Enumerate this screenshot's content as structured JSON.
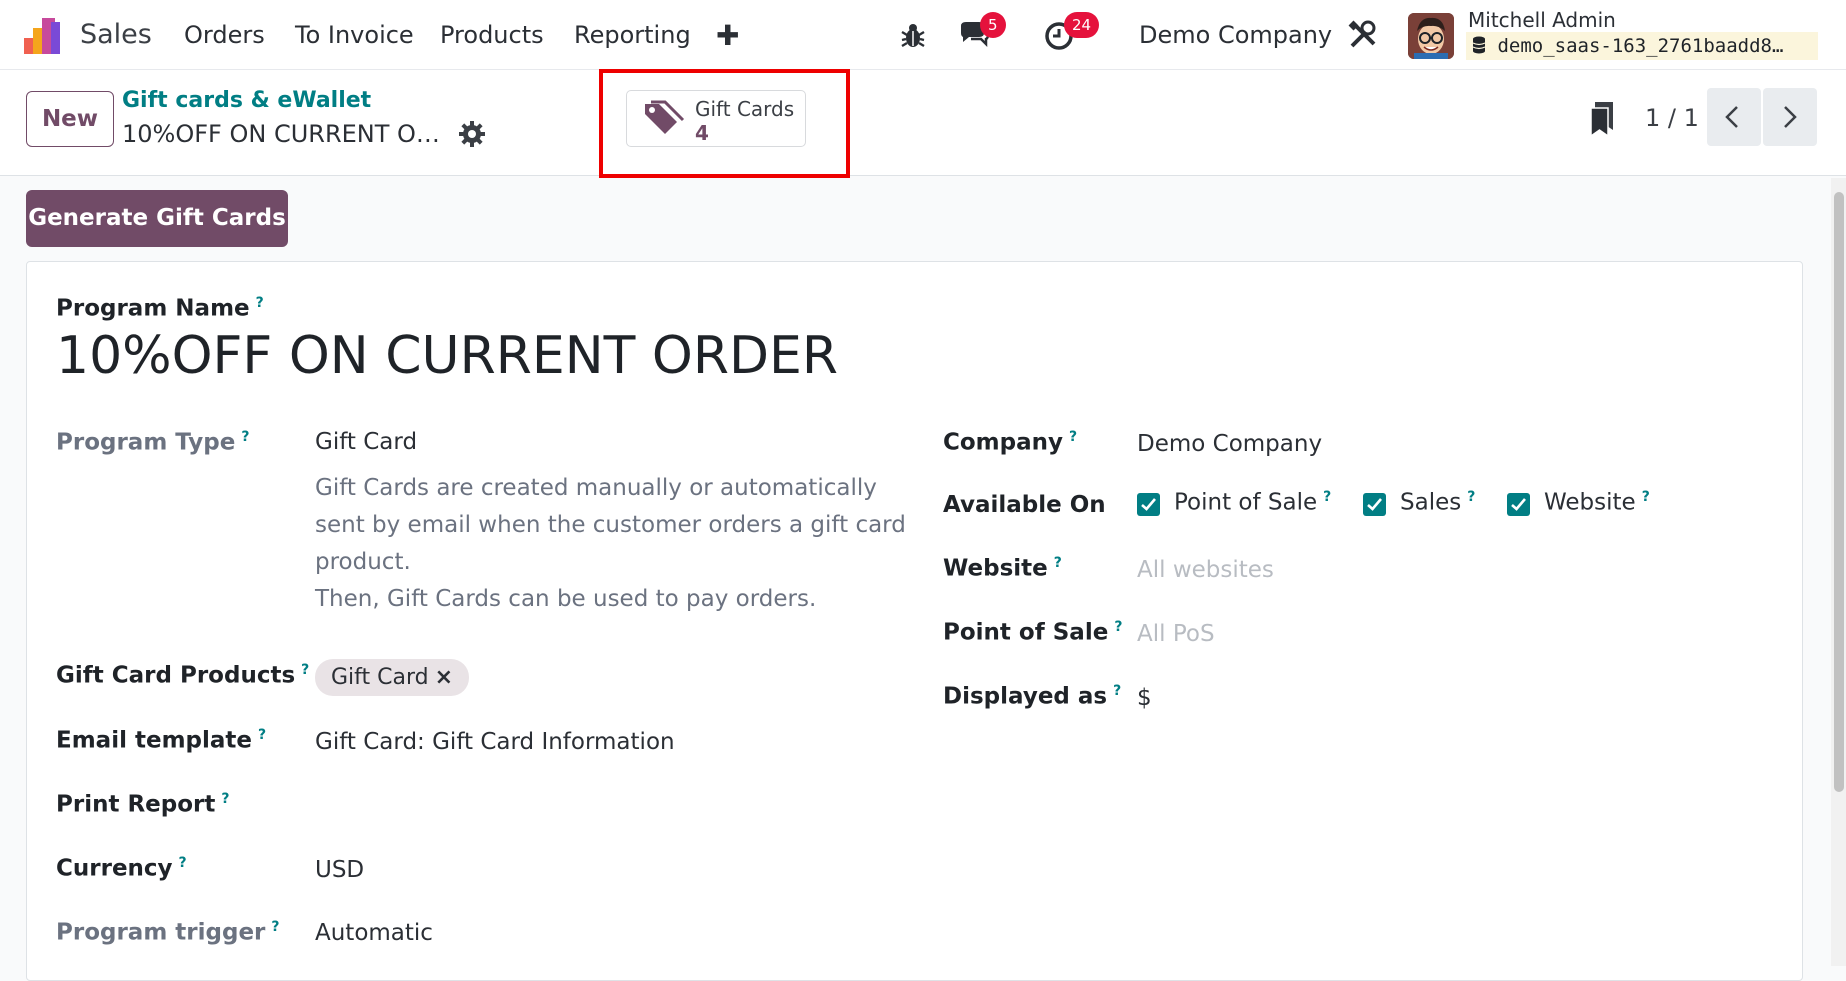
{
  "navbar": {
    "app_name": "Sales",
    "menu": [
      "Orders",
      "To Invoice",
      "Products",
      "Reporting"
    ],
    "add_symbol": "✚",
    "messages_count": "5",
    "activities_count": "24",
    "company": "Demo Company",
    "user_name": "Mitchell Admin",
    "database": "demo_saas-163_2761baadd8…"
  },
  "control_panel": {
    "new_label": "New",
    "breadcrumb": "Gift cards & eWallet",
    "record_title": "10%OFF ON CURRENT OR…",
    "smart_button": {
      "label": "Gift Cards",
      "count": "4"
    },
    "pager": "1 / 1"
  },
  "actions": {
    "generate_label": "Generate Gift Cards"
  },
  "form": {
    "help_mark": "?",
    "program_name_label": "Program Name",
    "program_name": "10%OFF ON CURRENT ORDER",
    "program_type_label": "Program Type",
    "program_type": "Gift Card",
    "program_type_desc_1": "Gift Cards are created manually or automatically sent by email when the customer orders a gift card product.",
    "program_type_desc_2": "Then, Gift Cards can be used to pay orders.",
    "gift_card_products_label": "Gift Card Products",
    "gift_card_product_tag": "Gift Card",
    "tag_remove": "×",
    "email_template_label": "Email template",
    "email_template": "Gift Card: Gift Card Information",
    "print_report_label": "Print Report",
    "currency_label": "Currency",
    "currency": "USD",
    "program_trigger_label": "Program trigger",
    "program_trigger": "Automatic",
    "company_label": "Company",
    "company": "Demo Company",
    "available_on_label": "Available On",
    "available_on": [
      {
        "label": "Point of Sale",
        "checked": true
      },
      {
        "label": "Sales",
        "checked": true
      },
      {
        "label": "Website",
        "checked": true
      }
    ],
    "website_label": "Website",
    "website_placeholder": "All websites",
    "pos_label": "Point of Sale",
    "pos_placeholder": "All PoS",
    "displayed_as_label": "Displayed as",
    "displayed_as": "$"
  },
  "colors": {
    "brand": "#714b67",
    "teal": "#017e84",
    "badge": "#e5123c",
    "highlight": "#ee0000"
  }
}
